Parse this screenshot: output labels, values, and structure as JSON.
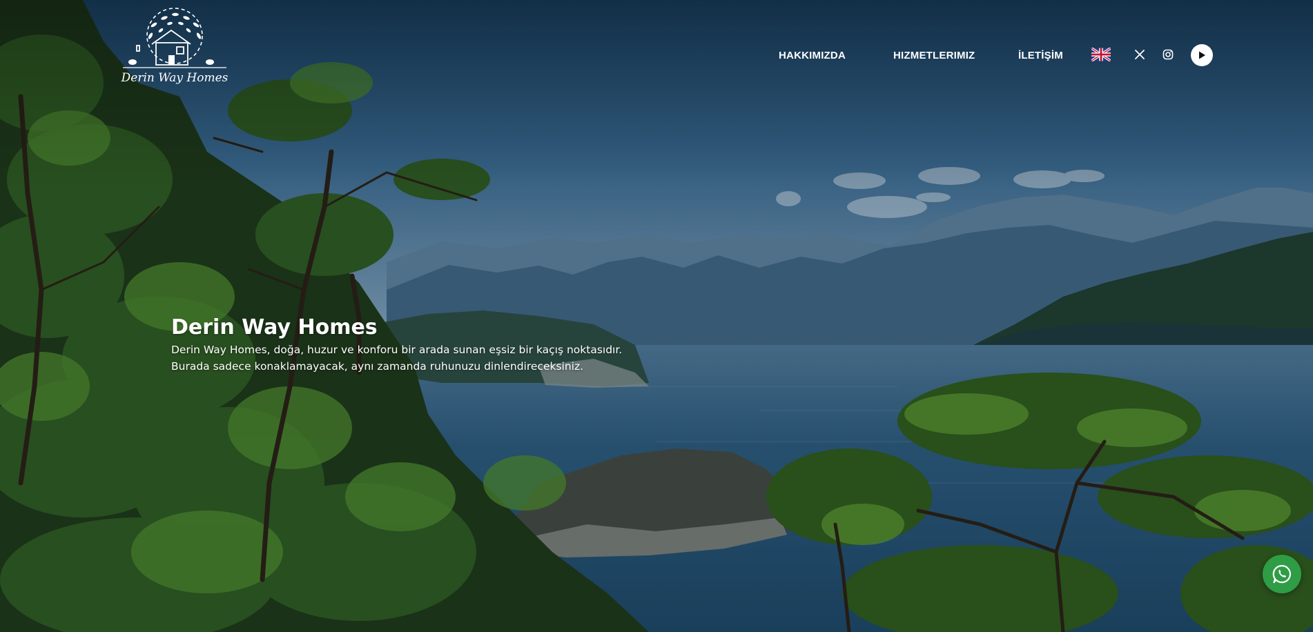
{
  "brand": {
    "name_script": "Derin Way Homes"
  },
  "nav": {
    "items": [
      {
        "label": "HAKKIMIZDA"
      },
      {
        "label": "HIZMETLERIMIZ"
      },
      {
        "label": "İLETİŞİM"
      }
    ]
  },
  "header_icons": {
    "language": "uk-flag-icon",
    "social": [
      "x-icon",
      "instagram-icon"
    ],
    "media": "play-icon"
  },
  "hero": {
    "title": "Derin Way Homes",
    "line1": "Derin Way Homes, doğa, huzur ve konforu bir arada sunan eşsiz bir kaçış noktasıdır.",
    "line2": "Burada sadece konaklamayacak, aynı zamanda ruhunuzu dinlendireceksiniz."
  },
  "floating": {
    "chat_icon": "whatsapp-icon"
  },
  "colors": {
    "sky_top": "#1f4d73",
    "sky_bottom": "#7f9fba",
    "sea": "#2e5d80",
    "whatsapp": "#2f9c46",
    "text": "#ffffff"
  }
}
